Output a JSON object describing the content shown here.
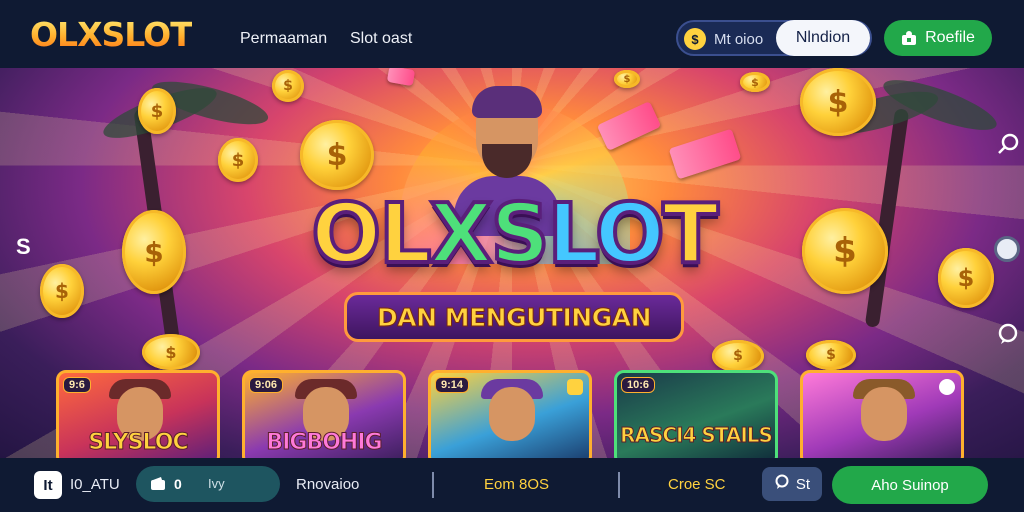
{
  "header": {
    "logo": "OLXSLOT",
    "nav": [
      "Permaaman",
      "Slot oast"
    ],
    "search": {
      "icon": "coin-icon",
      "icon_glyph": "$",
      "text": "Mt oioo"
    },
    "login_label": "Nlndion",
    "profile_label": "Roefile"
  },
  "hero": {
    "title_parts": [
      "OL",
      "XS",
      "LO",
      "T"
    ],
    "subtitle": "DAN MENGUTINGAN",
    "left_glyph": "S",
    "colors": {
      "title": "#ffd23f",
      "accent_green": "#4ee07a",
      "accent_blue": "#44c7ff"
    }
  },
  "cards": [
    {
      "badge": "9:6",
      "title": "SLYSLOC",
      "bg": "#c8335a"
    },
    {
      "badge": "9:06",
      "title": "BIGBOHIG",
      "bg": "#8a3ab0"
    },
    {
      "badge": "9:14",
      "title": "",
      "bg": "#3aa0d8"
    },
    {
      "badge": "10:6",
      "title": "RASCI4 STAILS",
      "bg": "#2a7a5a"
    },
    {
      "badge": "",
      "title": "",
      "bg": "#a03ab8"
    }
  ],
  "bottombar": {
    "logo_glyph": "It",
    "label": "I0_ATU",
    "pill": {
      "number": "0",
      "text": "Ivy"
    },
    "item_1": "Rnovaioo",
    "item_2": "Eom 8OS",
    "item_3": "Croe SC",
    "chip_label": "St",
    "cta_label": "Aho Suinop"
  }
}
